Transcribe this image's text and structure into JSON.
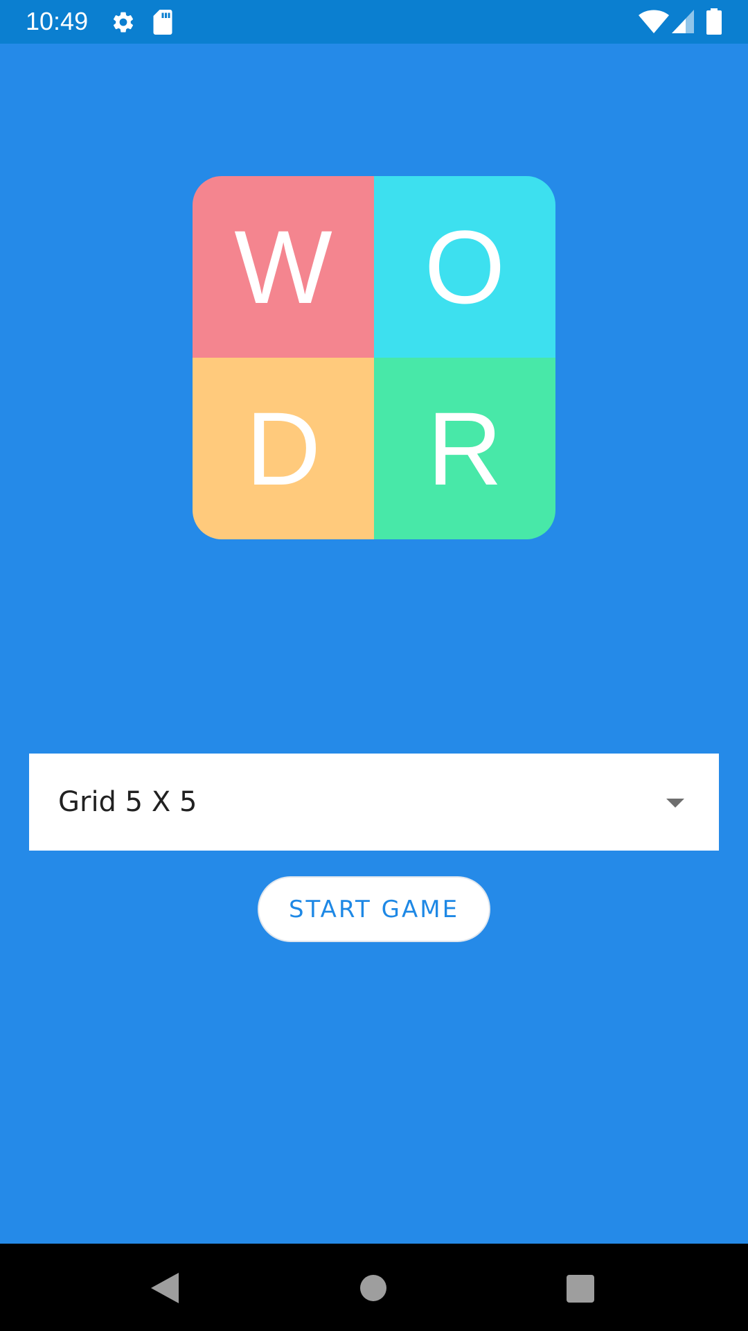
{
  "status_bar": {
    "time": "10:49",
    "background": "#0B7FD0",
    "icons": [
      "gear-icon",
      "sd-card-icon",
      "wifi-icon",
      "signal-icon",
      "battery-icon"
    ]
  },
  "logo": {
    "tiles": [
      {
        "letter": "W",
        "color": "#F4858F"
      },
      {
        "letter": "O",
        "color": "#3DE0EF"
      },
      {
        "letter": "D",
        "color": "#FFCA7C"
      },
      {
        "letter": "R",
        "color": "#48E8A8"
      }
    ]
  },
  "grid_select": {
    "selected": "Grid 5 X 5",
    "icon": "dropdown-arrow-icon"
  },
  "start_button": {
    "label": "START GAME",
    "text_color": "#1E88E5"
  },
  "nav_bar": {
    "icons": [
      "back-icon",
      "home-icon",
      "recents-icon"
    ]
  },
  "colors": {
    "background": "#258AE8"
  }
}
